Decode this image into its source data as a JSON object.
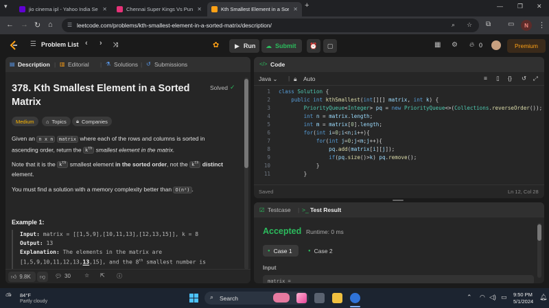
{
  "browser": {
    "tabs": [
      {
        "title": "jio cinema ipl - Yahoo India Sea",
        "fav_color": "#6001d2"
      },
      {
        "title": "Chennai Super Kings Vs Punjab",
        "fav_color": "#e63278"
      },
      {
        "title": "Kth Smallest Element in a Sorte",
        "fav_color": "#ffa116"
      }
    ],
    "new_tab": "+",
    "url": "leetcode.com/problems/kth-smallest-element-in-a-sorted-matrix/description/",
    "profile_initial": "N"
  },
  "lc_nav": {
    "problem_list": "Problem List",
    "run": "Run",
    "submit": "Submit",
    "streak": "0",
    "premium": "Premium"
  },
  "left_panel": {
    "tabs": [
      "Description",
      "Editorial",
      "Solutions",
      "Submissions"
    ],
    "title_line1": "378. Kth Smallest Element in a Sorted",
    "title_line2": "Matrix",
    "solved": "Solved",
    "tags": [
      "Medium",
      "Topics",
      "Companies"
    ],
    "p1_a": "Given an",
    "p1_code1": "n x n",
    "p1_code2": "matrix",
    "p1_b": "where each of the rows and columns is sorted in",
    "p1_c": "ascending order, return the",
    "p1_k": "k",
    "p1_th": "th",
    "p1_d": "smallest element in the matrix.",
    "p2_a": "Note that it is the",
    "p2_b": "smallest element",
    "p2_bold1": "in the sorted order",
    "p2_c": ", not the",
    "p2_bold2": "distinct",
    "p2_d": "element.",
    "p3": "You must find a solution with a memory complexity better than",
    "p3_code": "O(n²)",
    "p3_end": ".",
    "example_title": "Example 1:",
    "ex_input_label": "Input:",
    "ex_input": "matrix = [[1,5,9],[10,11,13],[12,13,15]], k = 8",
    "ex_output_label": "Output:",
    "ex_output": "13",
    "ex_expl_label": "Explanation:",
    "ex_expl": "The elements in the matrix are",
    "ex_expl2_a": "[1,5,9,10,11,12,13,",
    "ex_expl2_bold": "13",
    "ex_expl2_b": ",15], and the 8",
    "ex_expl2_th": "th",
    "ex_expl2_c": "smallest number is",
    "likes": "9.8K",
    "comments": "30"
  },
  "code_panel": {
    "title": "Code",
    "language": "Java",
    "mode": "Auto",
    "status": "Saved",
    "cursor": "Ln 12, Col 28",
    "lines": [
      {
        "n": "1",
        "t": "class Solution {"
      },
      {
        "n": "2",
        "t": "    public int kthSmallest(int[][] matrix, int k) {"
      },
      {
        "n": "3",
        "t": "        PriorityQueue<Integer> pq = new PriorityQueue<>(Collections.reverseOrder());"
      },
      {
        "n": "4",
        "t": "        int n = matrix.length;"
      },
      {
        "n": "5",
        "t": "        int m = matrix[0].length;"
      },
      {
        "n": "6",
        "t": "        for(int i=0;i<n;i++){"
      },
      {
        "n": "7",
        "t": "            for(int j=0;j<m;j++){"
      },
      {
        "n": "8",
        "t": "                pq.add(matrix[i][j]);"
      },
      {
        "n": "9",
        "t": "                if(pq.size()>k) pq.remove();"
      },
      {
        "n": "10",
        "t": "            }"
      },
      {
        "n": "11",
        "t": "        }"
      }
    ]
  },
  "result_panel": {
    "tab1": "Testcase",
    "tab2": "Test Result",
    "accepted": "Accepted",
    "runtime": "Runtime: 0 ms",
    "case1": "Case 1",
    "case2": "Case 2",
    "input_label": "Input",
    "input_preview": "matrix ="
  },
  "taskbar": {
    "temp": "84°F",
    "weather": "Partly cloudy",
    "search": "Search",
    "time": "9:50 PM",
    "date": "5/1/2024"
  }
}
